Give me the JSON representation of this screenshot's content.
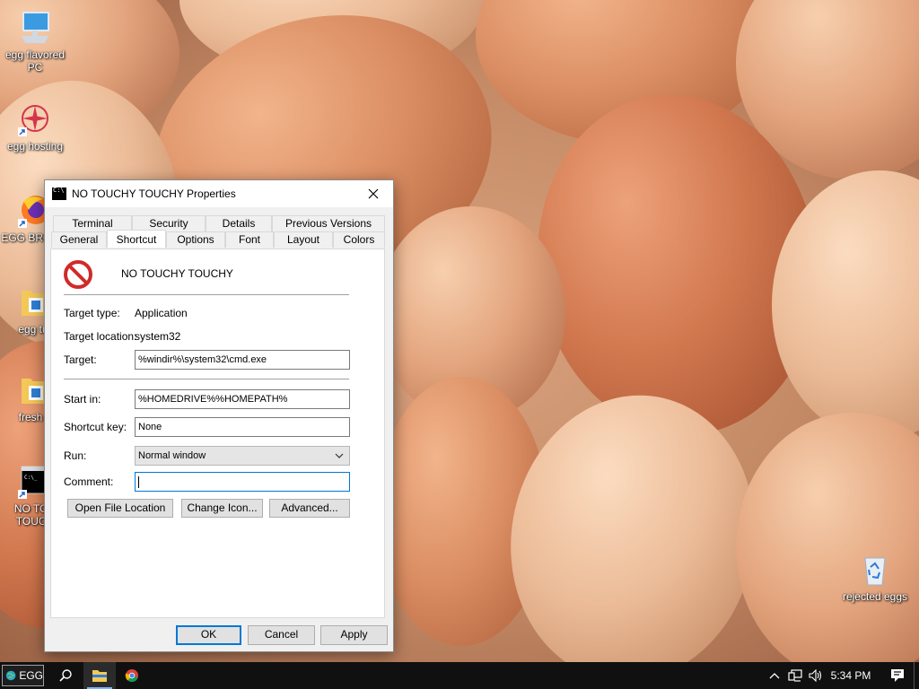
{
  "desktop": {
    "icons": [
      {
        "label": "egg flavored PC",
        "icon": "computer-icon"
      },
      {
        "label": "egg hosting",
        "icon": "egg-hosting-shortcut-icon"
      },
      {
        "label": "EGG BROWS",
        "icon": "firefox-icon"
      },
      {
        "label": "egg tur",
        "icon": "folder-icon"
      },
      {
        "label": "fresh e",
        "icon": "folder-icon"
      },
      {
        "label": "NO TOU TOUCH",
        "icon": "cmd-shortcut-icon"
      },
      {
        "label": "rejected eggs",
        "icon": "recycle-bin-icon"
      }
    ]
  },
  "dialog": {
    "title": "NO TOUCHY TOUCHY Properties",
    "tabs_row1": [
      "Terminal",
      "Security",
      "Details",
      "Previous Versions"
    ],
    "tabs_row2": [
      "General",
      "Shortcut",
      "Options",
      "Font",
      "Layout",
      "Colors"
    ],
    "active_tab": "Shortcut",
    "shortcut_name": "NO TOUCHY TOUCHY",
    "target_type_label": "Target type:",
    "target_type_value": "Application",
    "target_location_label": "Target location:",
    "target_location_value": "system32",
    "target_label": "Target:",
    "target_value": "%windir%\\system32\\cmd.exe",
    "start_in_label": "Start in:",
    "start_in_value": "%HOMEDRIVE%%HOMEPATH%",
    "shortcut_key_label": "Shortcut key:",
    "shortcut_key_value": "None",
    "run_label": "Run:",
    "run_value": "Normal window",
    "comment_label": "Comment:",
    "comment_value": "",
    "open_file_location": "Open File Location",
    "change_icon": "Change Icon...",
    "advanced": "Advanced...",
    "ok": "OK",
    "cancel": "Cancel",
    "apply": "Apply"
  },
  "taskbar": {
    "start_label": "EGG",
    "clock": "5:34 PM"
  },
  "colors": {
    "accent": "#0078d7",
    "taskbar": "#101010",
    "dialog_bg": "#f0f0f0"
  }
}
